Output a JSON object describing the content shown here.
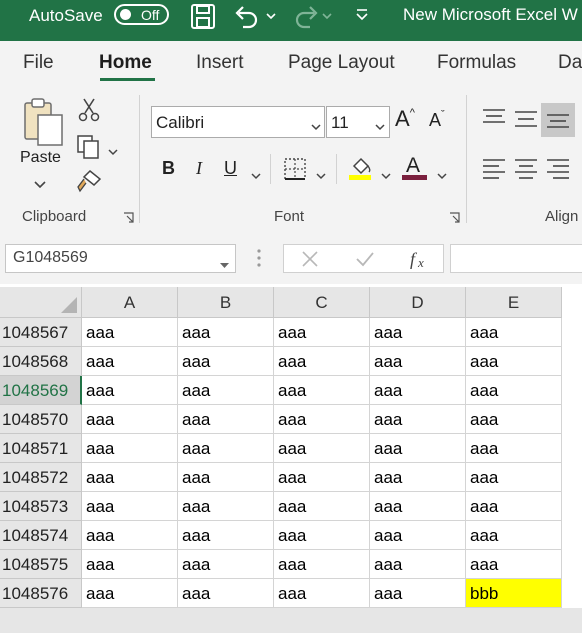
{
  "titlebar": {
    "autosave_label": "AutoSave",
    "autosave_state": "Off",
    "doc_title": "New Microsoft Excel W",
    "icons": [
      "save-icon",
      "undo-icon",
      "redo-icon",
      "customize-qat-icon"
    ]
  },
  "tabs": [
    {
      "label": "File",
      "active": false
    },
    {
      "label": "Home",
      "active": true
    },
    {
      "label": "Insert",
      "active": false
    },
    {
      "label": "Page Layout",
      "active": false
    },
    {
      "label": "Formulas",
      "active": false
    },
    {
      "label": "Da",
      "active": false
    }
  ],
  "ribbon": {
    "clipboard": {
      "paste_label": "Paste",
      "group_label": "Clipboard"
    },
    "font": {
      "font_name": "Calibri",
      "font_size": "11",
      "bold": "B",
      "italic": "I",
      "underline": "U",
      "grow": "A",
      "shrink": "A",
      "font_color_letter": "A",
      "group_label": "Font"
    },
    "alignment": {
      "group_label": "Align"
    }
  },
  "formula_bar": {
    "name_box": "G1048569",
    "formula_value": ""
  },
  "grid": {
    "columns": [
      "A",
      "B",
      "C",
      "D",
      "E"
    ],
    "active_row": "1048569",
    "rows": [
      {
        "num": "1048567",
        "cells": [
          "aaa",
          "aaa",
          "aaa",
          "aaa",
          "aaa"
        ]
      },
      {
        "num": "1048568",
        "cells": [
          "aaa",
          "aaa",
          "aaa",
          "aaa",
          "aaa"
        ]
      },
      {
        "num": "1048569",
        "cells": [
          "aaa",
          "aaa",
          "aaa",
          "aaa",
          "aaa"
        ]
      },
      {
        "num": "1048570",
        "cells": [
          "aaa",
          "aaa",
          "aaa",
          "aaa",
          "aaa"
        ]
      },
      {
        "num": "1048571",
        "cells": [
          "aaa",
          "aaa",
          "aaa",
          "aaa",
          "aaa"
        ]
      },
      {
        "num": "1048572",
        "cells": [
          "aaa",
          "aaa",
          "aaa",
          "aaa",
          "aaa"
        ]
      },
      {
        "num": "1048573",
        "cells": [
          "aaa",
          "aaa",
          "aaa",
          "aaa",
          "aaa"
        ]
      },
      {
        "num": "1048574",
        "cells": [
          "aaa",
          "aaa",
          "aaa",
          "aaa",
          "aaa"
        ]
      },
      {
        "num": "1048575",
        "cells": [
          "aaa",
          "aaa",
          "aaa",
          "aaa",
          "aaa"
        ]
      },
      {
        "num": "1048576",
        "cells": [
          "aaa",
          "aaa",
          "aaa",
          "aaa",
          "bbb"
        ]
      }
    ],
    "highlight_cell": {
      "row": "1048576",
      "col": "E",
      "fill": "#ffff00"
    }
  },
  "colors": {
    "excel_green": "#217346",
    "highlight_yellow": "#ffff00",
    "font_color_bar": "#7a1f3d",
    "fill_color_bar": "#ffff00"
  }
}
